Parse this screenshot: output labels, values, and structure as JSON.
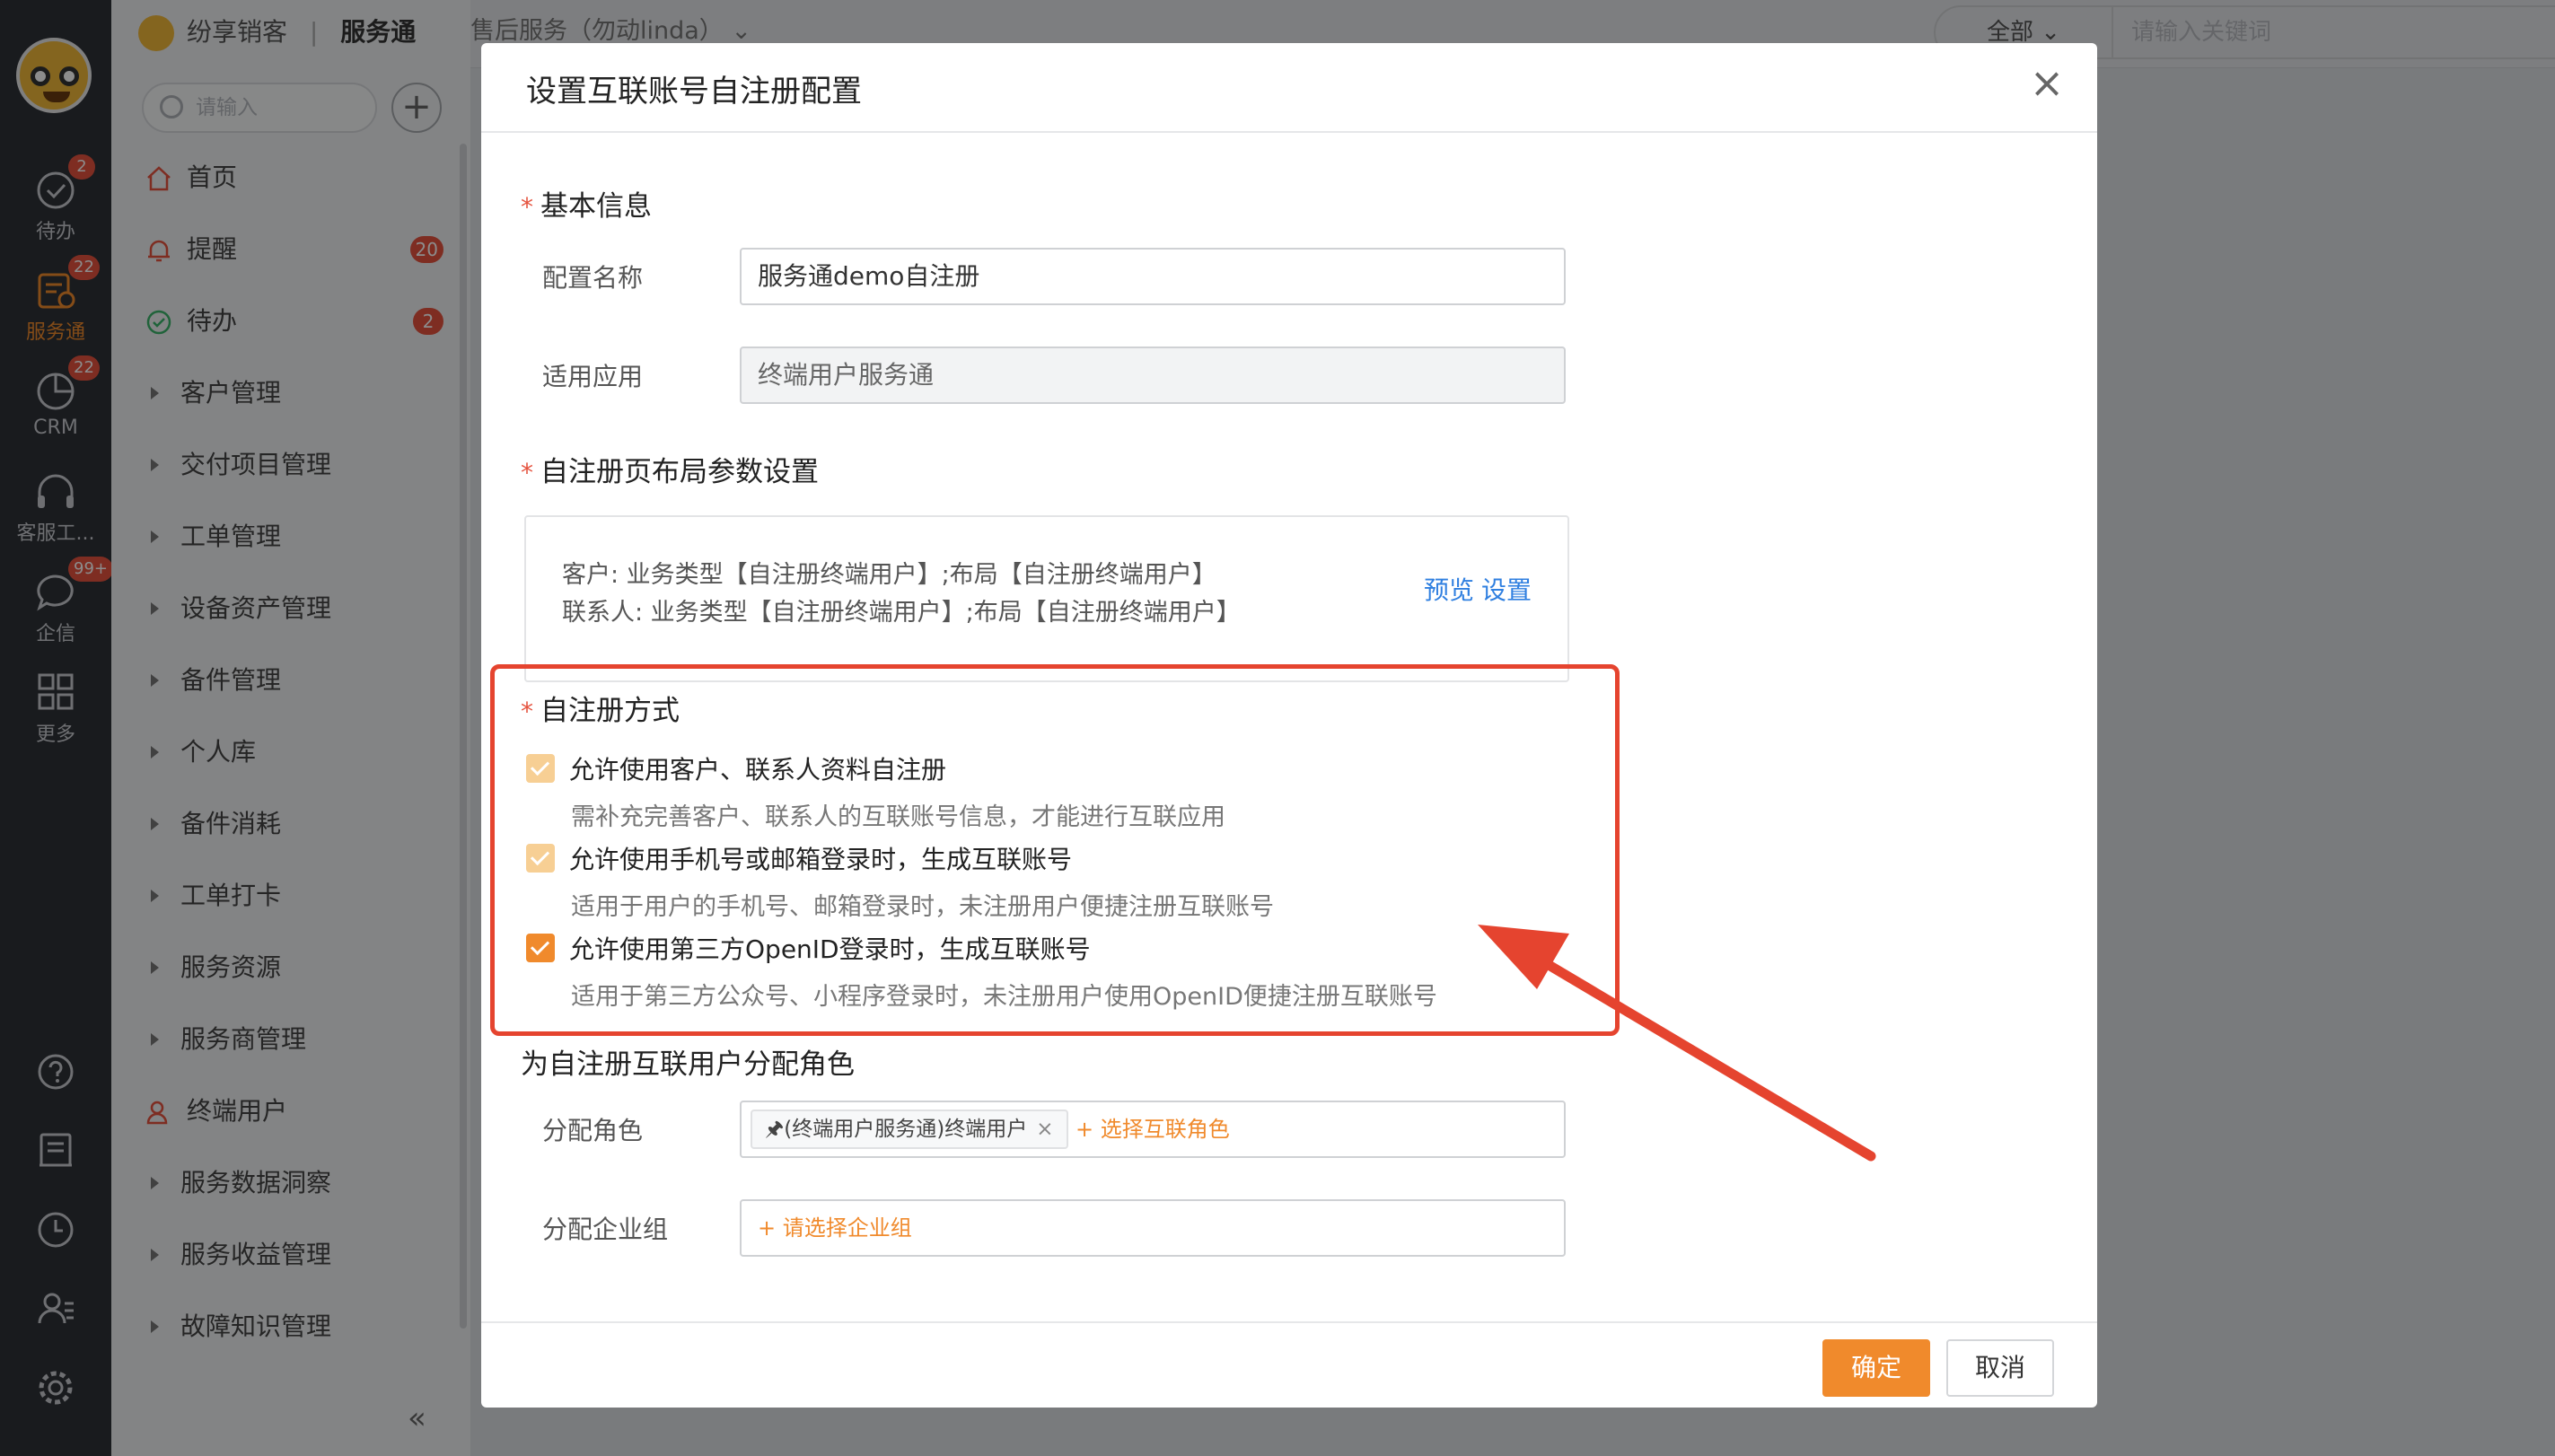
{
  "rail": {
    "items": [
      {
        "label": "待办",
        "badge": "2"
      },
      {
        "label": "服务通",
        "badge": "22"
      },
      {
        "label": "CRM",
        "badge": "22"
      },
      {
        "label": "客服工...",
        "badge": ""
      },
      {
        "label": "企信",
        "badge": "99+"
      },
      {
        "label": "更多",
        "badge": ""
      }
    ]
  },
  "sidebar": {
    "app_name": "纷享销客",
    "module": "服务通",
    "search_placeholder": "请输入",
    "items": [
      {
        "label": "首页",
        "badge": ""
      },
      {
        "label": "提醒",
        "badge": "20"
      },
      {
        "label": "待办",
        "badge": "2"
      },
      {
        "label": "客户管理"
      },
      {
        "label": "交付项目管理"
      },
      {
        "label": "工单管理"
      },
      {
        "label": "设备资产管理"
      },
      {
        "label": "备件管理"
      },
      {
        "label": "个人库"
      },
      {
        "label": "备件消耗"
      },
      {
        "label": "工单打卡"
      },
      {
        "label": "服务资源"
      },
      {
        "label": "服务商管理"
      },
      {
        "label": "终端用户"
      },
      {
        "label": "服务数据洞察"
      },
      {
        "label": "服务收益管理"
      },
      {
        "label": "故障知识管理"
      }
    ]
  },
  "topbar": {
    "sub_module": "售后服务（勿动linda）",
    "scope": "全部",
    "keyword_placeholder": "请输入关键词"
  },
  "dialog": {
    "title": "设置互联账号自注册配置",
    "basic": {
      "section": "基本信息",
      "name_label": "配置名称",
      "name_value": "服务通demo自注册",
      "app_label": "适用应用",
      "app_value": "终端用户服务通"
    },
    "layout": {
      "section": "自注册页布局参数设置",
      "line1": "客户: 业务类型【自注册终端用户】;布局【自注册终端用户】",
      "line2": "联系人: 业务类型【自注册终端用户】;布局【自注册终端用户】",
      "preview": "预览",
      "settings": "设置"
    },
    "mode": {
      "section": "自注册方式",
      "options": [
        {
          "label": "允许使用客户、联系人资料自注册",
          "desc": "需补充完善客户、联系人的互联账号信息，才能进行互联应用",
          "checked": true,
          "disabled": true
        },
        {
          "label": "允许使用手机号或邮箱登录时，生成互联账号",
          "desc": "适用于用户的手机号、邮箱登录时，未注册用户便捷注册互联账号",
          "checked": true,
          "disabled": true
        },
        {
          "label": "允许使用第三方OpenID登录时，生成互联账号",
          "desc": "适用于第三方公众号、小程序登录时，未注册用户使用OpenID便捷注册互联账号",
          "checked": true,
          "disabled": false
        }
      ]
    },
    "roles": {
      "section": "为自注册互联用户分配角色",
      "role_label": "分配角色",
      "role_tag": "(终端用户服务通)终端用户",
      "role_add": "+ 选择互联角色",
      "group_label": "分配企业组",
      "group_add": "+ 请选择企业组"
    },
    "ok": "确定",
    "cancel": "取消"
  },
  "colors": {
    "accent": "#f08a2c",
    "highlight": "#e5442f",
    "link": "#2f7fe0"
  }
}
